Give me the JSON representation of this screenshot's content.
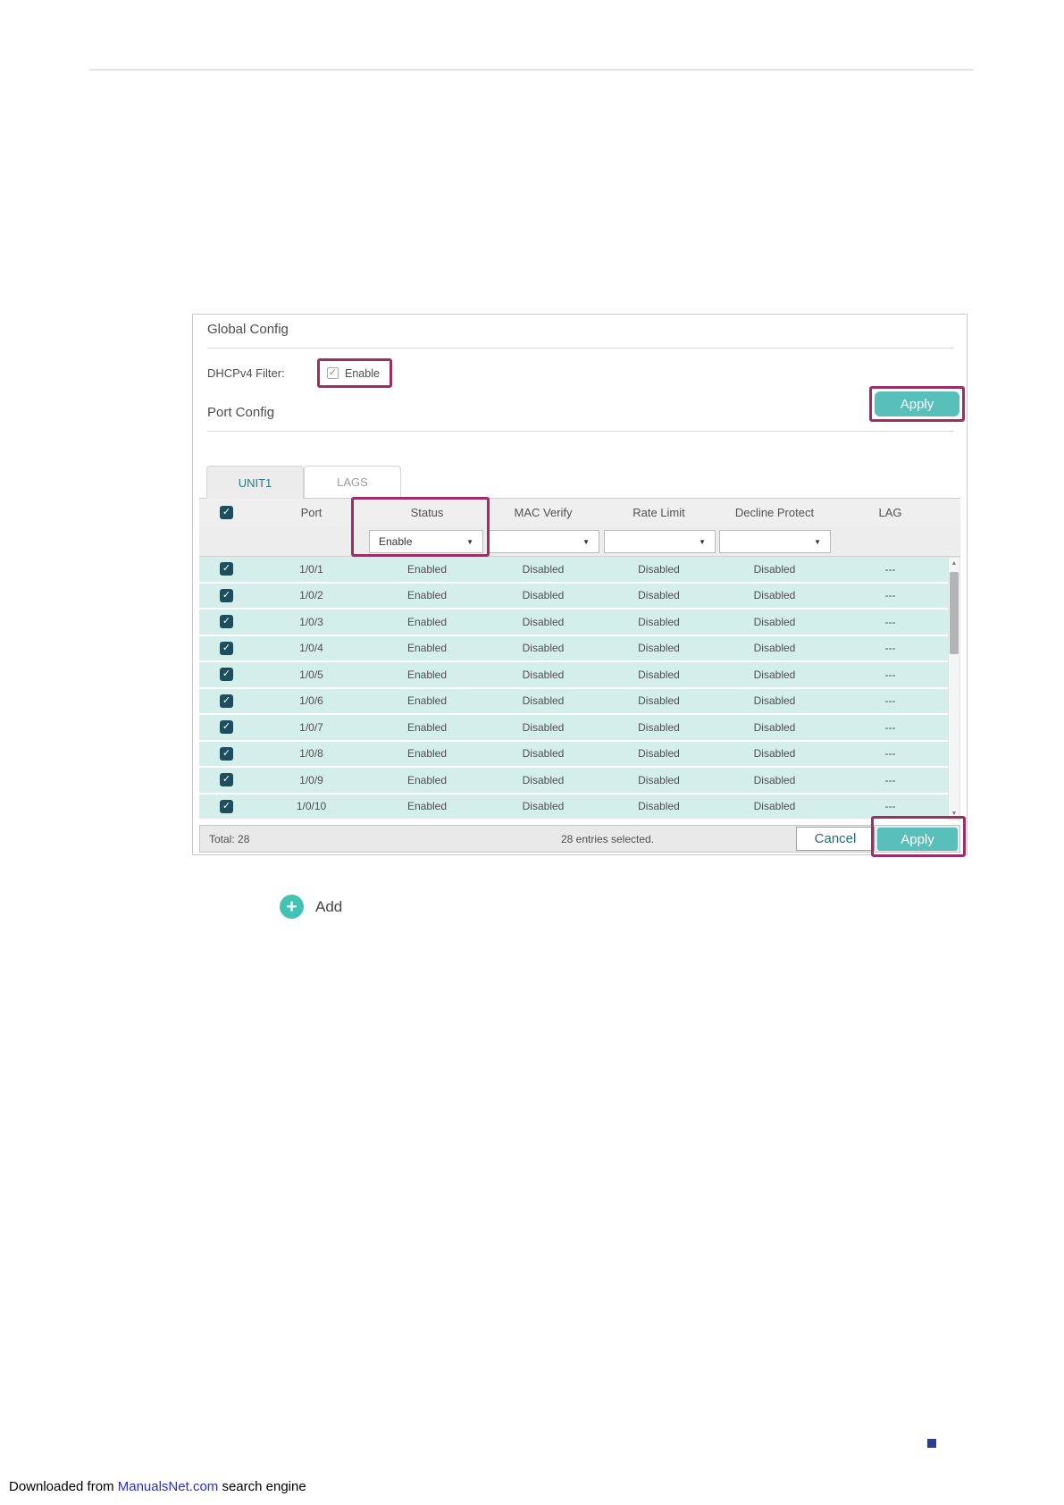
{
  "colors": {
    "accent_teal": "#58bfba",
    "highlight_magenta": "#9e2c67",
    "row_mint": "#d4eee9",
    "checkbox_dark": "#1e4d5e",
    "link_blue": "#2b2bdf",
    "square_navy": "#2d3c8e"
  },
  "icons": {
    "checkmark": "✓",
    "dropdown_arrow": "▼",
    "plus": "+",
    "scroll_up": "▲",
    "scroll_down": "▼"
  },
  "global_config": {
    "title": "Global Config",
    "dhcp_label": "DHCPv4 Filter:",
    "enable_label": "Enable",
    "apply_label": "Apply"
  },
  "port_config": {
    "title": "Port Config",
    "tabs": [
      {
        "label": "UNIT1"
      },
      {
        "label": "LAGS"
      }
    ],
    "columns": [
      "Port",
      "Status",
      "MAC Verify",
      "Rate Limit",
      "Decline Protect",
      "LAG"
    ],
    "status_filter_value": "Enable",
    "rows": [
      {
        "port": "1/0/1",
        "status": "Enabled",
        "mac_verify": "Disabled",
        "rate_limit": "Disabled",
        "decline_protect": "Disabled",
        "lag": "---"
      },
      {
        "port": "1/0/2",
        "status": "Enabled",
        "mac_verify": "Disabled",
        "rate_limit": "Disabled",
        "decline_protect": "Disabled",
        "lag": "---"
      },
      {
        "port": "1/0/3",
        "status": "Enabled",
        "mac_verify": "Disabled",
        "rate_limit": "Disabled",
        "decline_protect": "Disabled",
        "lag": "---"
      },
      {
        "port": "1/0/4",
        "status": "Enabled",
        "mac_verify": "Disabled",
        "rate_limit": "Disabled",
        "decline_protect": "Disabled",
        "lag": "---"
      },
      {
        "port": "1/0/5",
        "status": "Enabled",
        "mac_verify": "Disabled",
        "rate_limit": "Disabled",
        "decline_protect": "Disabled",
        "lag": "---"
      },
      {
        "port": "1/0/6",
        "status": "Enabled",
        "mac_verify": "Disabled",
        "rate_limit": "Disabled",
        "decline_protect": "Disabled",
        "lag": "---"
      },
      {
        "port": "1/0/7",
        "status": "Enabled",
        "mac_verify": "Disabled",
        "rate_limit": "Disabled",
        "decline_protect": "Disabled",
        "lag": "---"
      },
      {
        "port": "1/0/8",
        "status": "Enabled",
        "mac_verify": "Disabled",
        "rate_limit": "Disabled",
        "decline_protect": "Disabled",
        "lag": "---"
      },
      {
        "port": "1/0/9",
        "status": "Enabled",
        "mac_verify": "Disabled",
        "rate_limit": "Disabled",
        "decline_protect": "Disabled",
        "lag": "---"
      },
      {
        "port": "1/0/10",
        "status": "Enabled",
        "mac_verify": "Disabled",
        "rate_limit": "Disabled",
        "decline_protect": "Disabled",
        "lag": "---"
      }
    ],
    "footer": {
      "total": "Total: 28",
      "selected": "28 entries selected.",
      "cancel_label": "Cancel",
      "apply_label": "Apply"
    }
  },
  "add_button": {
    "label": "Add"
  },
  "page_footer": {
    "prefix": "Downloaded from ",
    "link": "ManualsNet.com",
    "suffix": " search engine"
  }
}
